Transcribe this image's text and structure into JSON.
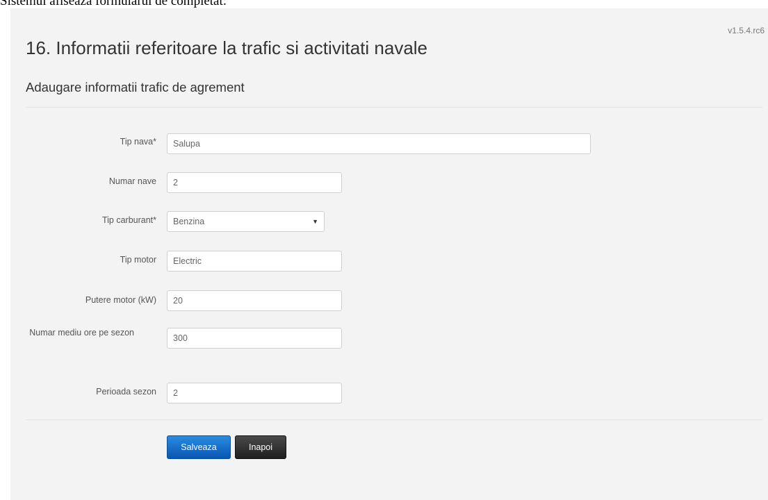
{
  "caption": "Sistemul afiseaza formularul de completat:",
  "version": "v1.5.4.rc6",
  "page_title": "16. Informatii referitoare la trafic si activitati navale",
  "section_title": "Adaugare informatii trafic de agrement",
  "form": {
    "tip_nava": {
      "label": "Tip nava*",
      "value": "Salupa"
    },
    "numar_nave": {
      "label": "Numar nave",
      "value": "2"
    },
    "tip_carburant": {
      "label": "Tip carburant*",
      "value": "Benzina"
    },
    "tip_motor": {
      "label": "Tip motor",
      "value": "Electric"
    },
    "putere_motor": {
      "label": "Putere motor (kW)",
      "value": "20"
    },
    "numar_mediu_ore": {
      "label": "Numar mediu ore pe sezon",
      "value": "300"
    },
    "perioada_sezon": {
      "label": "Perioada sezon",
      "value": "2"
    }
  },
  "buttons": {
    "save": "Salveaza",
    "back": "Inapoi"
  },
  "icons": {
    "select_arrow": "caret-down-icon"
  }
}
